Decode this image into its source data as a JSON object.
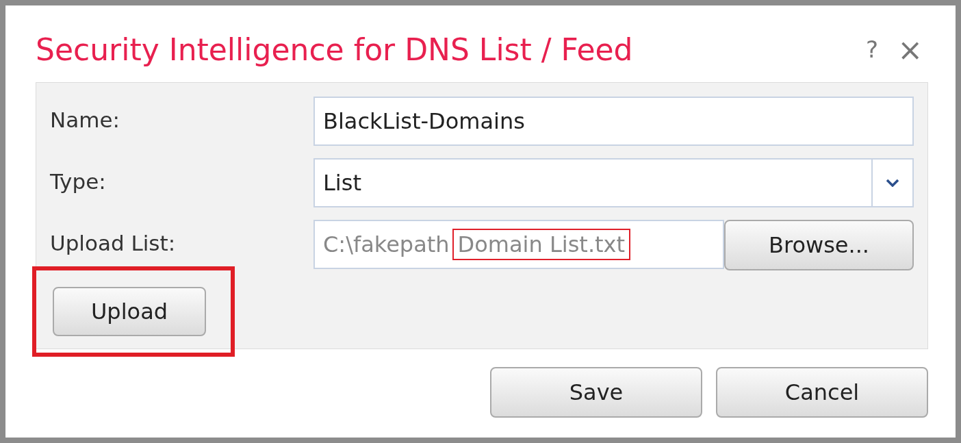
{
  "dialog": {
    "title": "Security Intelligence for DNS List / Feed",
    "help": "?",
    "close": "×"
  },
  "fields": [
    {
      "kind": "text",
      "label": "Name:",
      "value": "BlackList-Domains"
    },
    {
      "kind": "select",
      "label": "Type:",
      "value": "List"
    },
    {
      "kind": "file",
      "label": "Upload List:",
      "path": "C:\\fakepath",
      "file_name": "Domain List.txt",
      "file_name_highlighted": true,
      "browse": "Browse..."
    }
  ],
  "upload_button": {
    "label": "Upload",
    "highlighted": true
  },
  "buttons": [
    {
      "label": "Save"
    },
    {
      "label": "Cancel"
    }
  ]
}
